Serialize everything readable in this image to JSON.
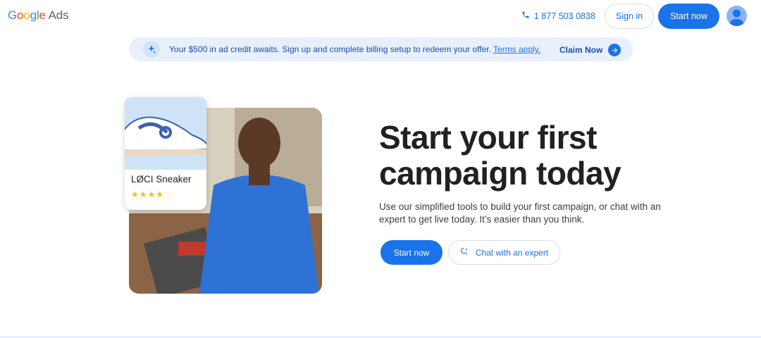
{
  "header": {
    "logo_google": [
      "G",
      "o",
      "o",
      "g",
      "l",
      "e"
    ],
    "logo_ads": "Ads",
    "phone": "1 877 503 0838",
    "sign_in": "Sign in",
    "start_now": "Start now"
  },
  "banner": {
    "text": "Your $500 in ad credit awaits. Sign up and complete billing setup to redeem your offer.",
    "terms": "Terms apply.",
    "claim": "Claim Now"
  },
  "product_card": {
    "name": "LØCI Sneaker",
    "rating": 4,
    "rating_max": 5
  },
  "hero": {
    "headline": "Start your first campaign today",
    "subtext": "Use our simplified tools to build your first campaign, or chat with an expert to get live today. It’s easier than you think.",
    "start_now": "Start now",
    "chat": "Chat with an expert"
  },
  "icons": [
    "phone-icon",
    "avatar",
    "sparkle-icon",
    "arrow-right-icon",
    "chat-icon",
    "star-icon"
  ],
  "colors": {
    "primary": "#1a73e8",
    "banner_bg": "#e8f0fe",
    "star": "#fbbc04"
  }
}
